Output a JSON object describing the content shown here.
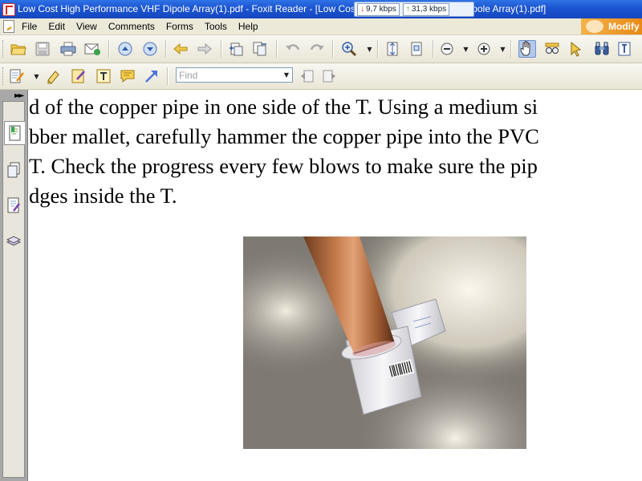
{
  "window": {
    "title": "Low Cost High Performance VHF Dipole Array(1).pdf - Foxit Reader - [Low Cost High Performance VHF Dipole Array(1).pdf]"
  },
  "network_monitor": {
    "download_speed": "9,7 kbps",
    "upload_speed": "31,3 kbps"
  },
  "menu": {
    "items": [
      "File",
      "Edit",
      "View",
      "Comments",
      "Forms",
      "Tools",
      "Help"
    ],
    "badge": "Modify"
  },
  "toolbar": {
    "find_placeholder": "Find"
  },
  "document": {
    "lines": [
      "d of the copper pipe in one side of the T. Using a medium si",
      "bber mallet, carefully hammer the copper pipe into the PVC",
      "T. Check the progress every few blows to make sure the pip",
      "dges inside the T."
    ]
  },
  "colors": {
    "titlebar": "#1f5ad6",
    "menubar": "#ece9d8",
    "accent_orange": "#e98a17",
    "sidepanel": "#a8a8a8"
  }
}
